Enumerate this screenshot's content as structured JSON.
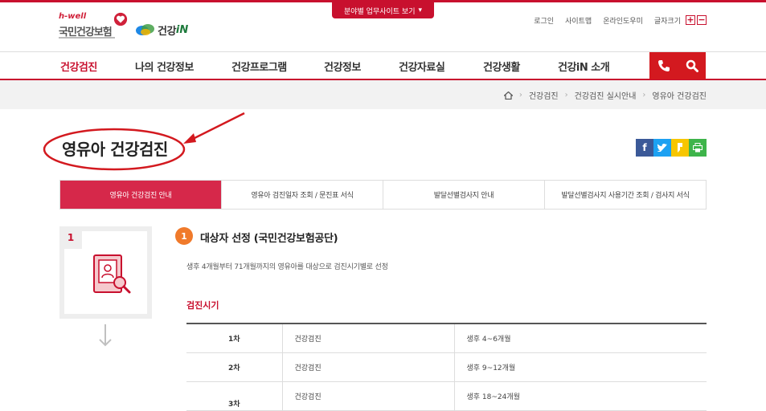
{
  "header": {
    "logo_hwell": "h-well",
    "logo_nhis": "국민건강보험",
    "logo_gin_prefix": "건강",
    "logo_gin_suffix": "iN",
    "dropdown_label": "분야별 업무사이트 보기",
    "util": {
      "login": "로그인",
      "sitemap": "사이트맵",
      "help": "온라인도우미",
      "fontsize_label": "글자크기",
      "plus": "+",
      "minus": "−"
    }
  },
  "gnb": {
    "items": [
      "건강검진",
      "나의 건강정보",
      "건강프로그램",
      "건강정보",
      "건강자료실",
      "건강생활",
      "건강iN 소개"
    ],
    "active_index": 0
  },
  "breadcrumb": [
    "건강검진",
    "건강검진 실시안내",
    "영유아 건강검진"
  ],
  "page_title": "영유아 건강검진",
  "share": {
    "icons": [
      "facebook-icon",
      "twitter-icon",
      "kakaostory-icon",
      "print-icon"
    ],
    "colors": [
      "#3b5998",
      "#1da1f2",
      "#f7c600",
      "#3eb44a"
    ]
  },
  "subtabs": [
    "영유아 건강검진 안내",
    "영유아 검진일자 조회 / 문진표 서식",
    "발달선별검사지 안내",
    "발달선별검사지 사용기간 조회 / 검사지 서식"
  ],
  "step": {
    "number": "1"
  },
  "section": {
    "number": "1",
    "title": "대상자 선정 (국민건강보험공단)",
    "description": "생후 4개월부터 71개월까지의 영유아를 대상으로 검진시기별로 선정",
    "sub_heading": "검진시기",
    "rows": [
      {
        "round": "1차",
        "kind": "건강검진",
        "period": "생후 4~6개월"
      },
      {
        "round": "2차",
        "kind": "건강검진",
        "period": "생후 9~12개월"
      },
      {
        "round": "3차",
        "kind": "건강검진",
        "period": "생후 18~24개월"
      }
    ]
  },
  "colors": {
    "brand_red": "#c8102e",
    "active_tab": "#d6284a",
    "section_badge": "#f07a2b"
  }
}
